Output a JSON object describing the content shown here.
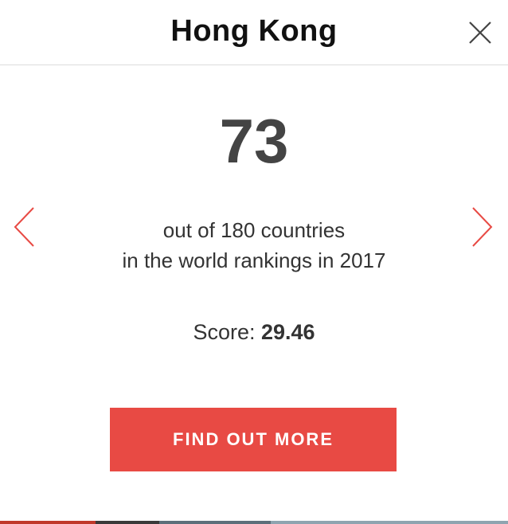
{
  "header": {
    "title": "Hong Kong"
  },
  "content": {
    "rank": "73",
    "description_line1": "out of 180 countries",
    "description_line2": "in the world rankings in 2017",
    "score_label": "Score: ",
    "score_value": "29.46"
  },
  "actions": {
    "cta_label": "FIND OUT MORE"
  },
  "icons": {
    "close": "close-icon",
    "prev": "chevron-left-icon",
    "next": "chevron-right-icon"
  },
  "colors": {
    "accent": "#e84a44",
    "title": "#111111",
    "rank": "#444444"
  }
}
